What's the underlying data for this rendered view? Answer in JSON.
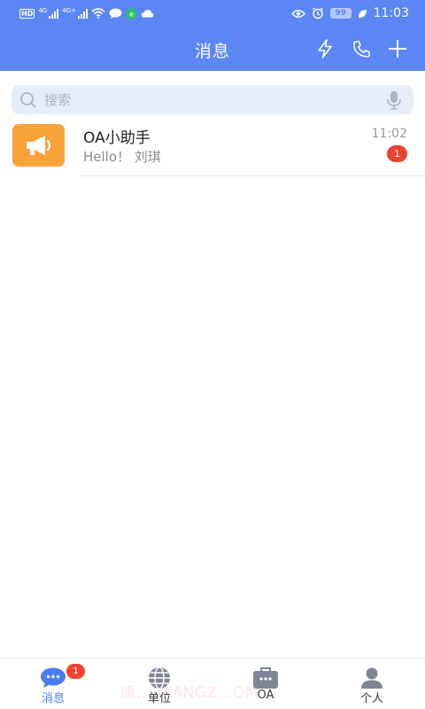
{
  "status_bar": {
    "left_badge": "HD",
    "network_1": "4G",
    "network_2": "4G+",
    "battery": "99",
    "time": "11:03"
  },
  "header": {
    "title": "消息",
    "actions": [
      "lightning-icon",
      "phone-icon",
      "plus-icon"
    ]
  },
  "search": {
    "placeholder": "搜索"
  },
  "conversations": [
    {
      "name": "OA小助手",
      "preview": "Hello！ 刘琪",
      "time": "11:02",
      "unread": "1",
      "avatar_icon": "megaphone-icon"
    }
  ],
  "bottom_nav": {
    "items": [
      {
        "label": "消息",
        "icon": "chat-bubble-icon",
        "badge": "1",
        "active": true
      },
      {
        "label": "单位",
        "icon": "globe-icon",
        "active": false
      },
      {
        "label": "OA",
        "icon": "briefcase-icon",
        "active": false
      },
      {
        "label": "个人",
        "icon": "person-icon",
        "active": false
      }
    ]
  },
  "watermark": "康...· KANGZ...OM",
  "colors": {
    "header_blue": "#5b86f3",
    "accent_blue": "#4a7cf5",
    "avatar_orange": "#f8a33a",
    "badge_red": "#ee4232"
  }
}
